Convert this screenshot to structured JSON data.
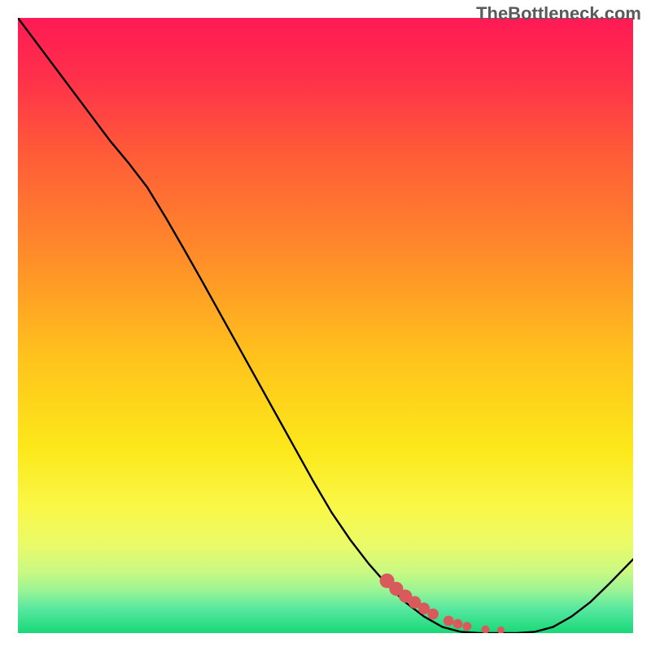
{
  "watermark": "TheBottleneck.com",
  "chart_data": {
    "type": "line",
    "title": "",
    "xlabel": "",
    "ylabel": "",
    "xlim": [
      0,
      100
    ],
    "ylim": [
      0,
      100
    ],
    "x": [
      0,
      3,
      6,
      9,
      12,
      15,
      18,
      21,
      24,
      27,
      30,
      33,
      36,
      39,
      42,
      45,
      48,
      51,
      54,
      57,
      60,
      63,
      66,
      69,
      72,
      75,
      78,
      81,
      84,
      87,
      90,
      93,
      96,
      100
    ],
    "y": [
      100,
      96,
      92,
      88,
      84,
      80,
      76.4,
      72.5,
      67.6,
      62.4,
      57.1,
      51.7,
      46.3,
      40.9,
      35.5,
      30.1,
      24.7,
      19.6,
      15.2,
      11.3,
      7.9,
      5.0,
      2.7,
      1.0,
      0.2,
      0.0,
      0.0,
      0.0,
      0.2,
      1.0,
      2.7,
      5.0,
      7.9,
      12.0
    ],
    "highlight": {
      "x": [
        60,
        61.5,
        63,
        64.5,
        66,
        67.5,
        70,
        71.5,
        73,
        76,
        78.5
      ],
      "y": [
        8.5,
        7.2,
        6.0,
        5.0,
        4.0,
        3.1,
        2.0,
        1.5,
        1.1,
        0.6,
        0.5
      ]
    },
    "background_gradient": {
      "stops": [
        {
          "offset": 0,
          "color": "#ff1a55"
        },
        {
          "offset": 0.1,
          "color": "#ff314a"
        },
        {
          "offset": 0.22,
          "color": "#ff5b38"
        },
        {
          "offset": 0.38,
          "color": "#ff8a2a"
        },
        {
          "offset": 0.55,
          "color": "#ffc21c"
        },
        {
          "offset": 0.7,
          "color": "#fce81a"
        },
        {
          "offset": 0.8,
          "color": "#f9f84a"
        },
        {
          "offset": 0.86,
          "color": "#e8fa6a"
        },
        {
          "offset": 0.9,
          "color": "#c9f982"
        },
        {
          "offset": 0.93,
          "color": "#9cf494"
        },
        {
          "offset": 0.96,
          "color": "#58e8a0"
        },
        {
          "offset": 1.0,
          "color": "#18d878"
        }
      ]
    },
    "curve_color": "#000000",
    "highlight_color": "#d85a5a"
  }
}
